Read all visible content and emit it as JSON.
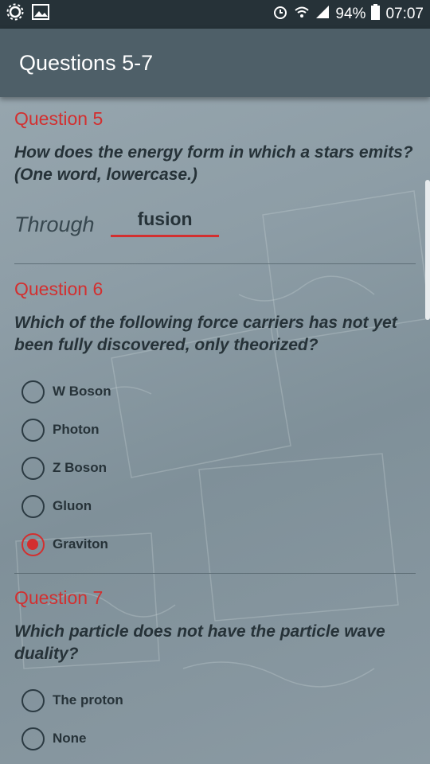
{
  "status_bar": {
    "left_icons": [
      "settings-icon",
      "image-icon"
    ],
    "right_icons": [
      "alarm-icon",
      "wifi-icon",
      "signal-icon"
    ],
    "battery": "94%",
    "time": "07:07"
  },
  "app_bar": {
    "title": "Questions 5-7"
  },
  "questions": [
    {
      "title": "Question 5",
      "text": "How does the energy form in which a stars emits? (One word, lowercase.)",
      "prefix": "Through",
      "answer": "fusion"
    },
    {
      "title": "Question 6",
      "text": "Which of the following force carriers has not yet been fully discovered, only theorized?",
      "options": [
        {
          "label": "W Boson",
          "checked": false
        },
        {
          "label": "Photon",
          "checked": false
        },
        {
          "label": "Z Boson",
          "checked": false
        },
        {
          "label": "Gluon",
          "checked": false
        },
        {
          "label": "Graviton",
          "checked": true
        }
      ]
    },
    {
      "title": "Question 7",
      "text": "Which particle does not have the particle wave duality?",
      "options": [
        {
          "label": "The proton",
          "checked": false
        },
        {
          "label": "None",
          "checked": false
        }
      ]
    }
  ],
  "colors": {
    "accent": "#d32f2f",
    "app_bar": "#4e5f68",
    "status_bar": "#263238"
  }
}
